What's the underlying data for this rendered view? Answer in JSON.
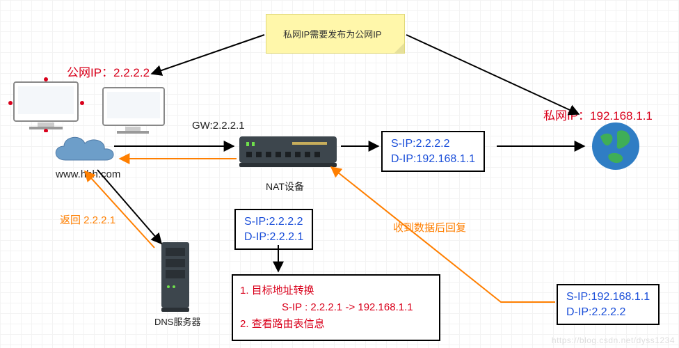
{
  "sticky": {
    "text": "私网IP需要发布为公网IP"
  },
  "public_ip_label": "公网IP：2.2.2.2",
  "private_ip_label": "私网IP：192.168.1.1",
  "gw_label": "GW:2.2.2.1",
  "nat_label": "NAT设备",
  "dns_label": "DNS服务器",
  "domain_label": "www.hhh.com",
  "dns_reply_label": "返回 2.2.2.1",
  "reply_label": "收到数据后回复",
  "packets": {
    "outgoing": {
      "sip": "S-IP:2.2.2.2",
      "dip": "D-IP:192.168.1.1"
    },
    "to_nat": {
      "sip": "S-IP:2.2.2.2",
      "dip": "D-IP:2.2.2.1"
    },
    "return": {
      "sip": "S-IP:192.168.1.1",
      "dip": "D-IP:2.2.2.2"
    }
  },
  "nat_steps": {
    "line1": "1. 目标地址转换",
    "line2_prefix": "S-IP : 2.2.2.1 -> 192.168.1.1",
    "line3": "2. 查看路由表信息"
  },
  "watermark": "https://blog.csdn.net/dyss1234"
}
